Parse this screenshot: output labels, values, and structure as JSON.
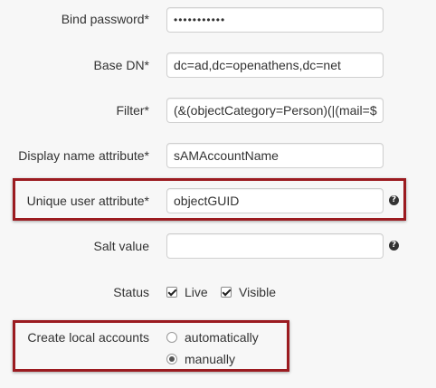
{
  "form": {
    "bind_password": {
      "label": "Bind password*",
      "value": "•••••••••••"
    },
    "base_dn": {
      "label": "Base DN*",
      "value": "dc=ad,dc=openathens,dc=net"
    },
    "filter": {
      "label": "Filter*",
      "value": "(&(objectCategory=Person)(|(mail=$"
    },
    "display_name": {
      "label": "Display name attribute*",
      "value": "sAMAccountName"
    },
    "unique_user": {
      "label": "Unique user attribute*",
      "value": "objectGUID"
    },
    "salt": {
      "label": "Salt value",
      "value": ""
    },
    "status": {
      "label": "Status",
      "options": [
        {
          "label": "Live",
          "checked": true
        },
        {
          "label": "Visible",
          "checked": true
        }
      ]
    },
    "create_local": {
      "label": "Create local accounts",
      "options": [
        {
          "label": "automatically",
          "selected": false
        },
        {
          "label": "manually",
          "selected": true
        }
      ]
    }
  },
  "help_icon": "question-circle-icon",
  "colors": {
    "highlight": "#9b1b20",
    "background": "#f7f7f7"
  }
}
